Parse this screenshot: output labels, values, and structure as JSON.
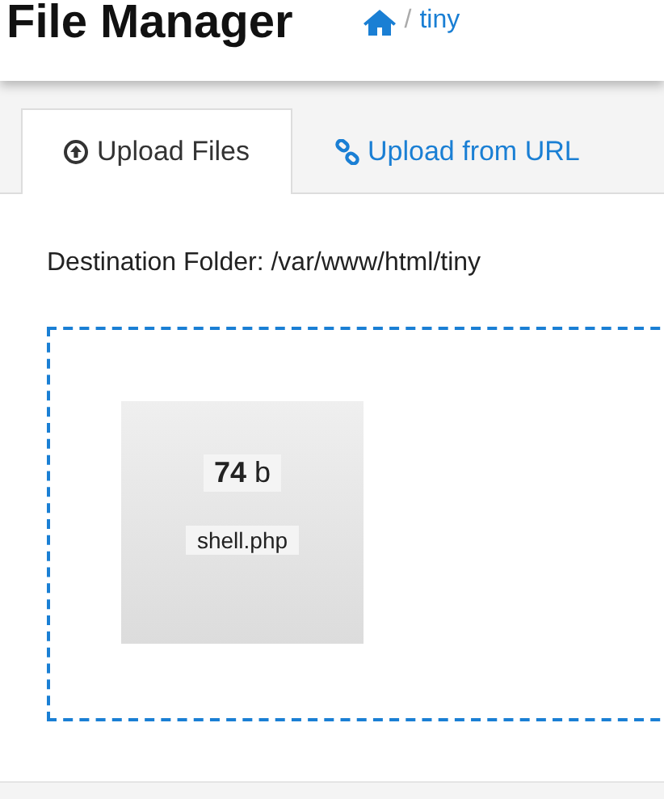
{
  "header": {
    "title": "File Manager",
    "breadcrumb": [
      {
        "kind": "home"
      },
      {
        "kind": "text",
        "label": "/"
      },
      {
        "kind": "link",
        "label": "tiny"
      }
    ]
  },
  "tabs": [
    {
      "label": "Upload Files",
      "kind": "upload",
      "selected": true
    },
    {
      "label": "Upload from URL",
      "kind": "link",
      "selected": false
    }
  ],
  "destination": "Destination Folder: /var/www/html/tiny",
  "files": [
    {
      "size": "**74** b",
      "name": "shell.php"
    }
  ]
}
